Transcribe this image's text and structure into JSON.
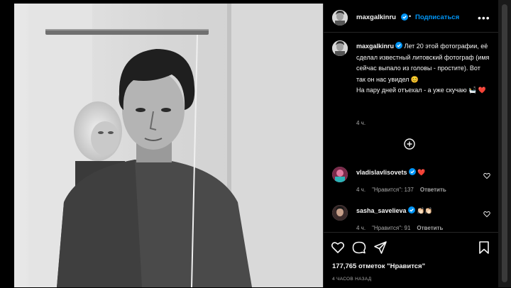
{
  "post": {
    "author": "maxgalkinru",
    "follow_label": "Подписаться",
    "separator": "•",
    "more_label": "•••",
    "caption": {
      "username": "maxgalkinru",
      "line1": " Лет 20 этой фотографии, её сделал известный литовский фотограф (имя сейчас выпало из головы - простите). Вот так он нас увидел 😊",
      "line2": "На пару дней отъехал - а уже скучаю 🛀 ❤️",
      "time": "4 ч."
    }
  },
  "comments": [
    {
      "username": "vladislavlisovets",
      "text": "❤️",
      "time": "4 ч.",
      "likes": "\"Нравится\": 137",
      "reply": "Ответить"
    },
    {
      "username": "sasha_savelieva",
      "text": "👏🏻👏🏻",
      "time": "4 ч.",
      "likes": "\"Нравится\": 91",
      "reply": "Ответить"
    }
  ],
  "footer": {
    "likes_count": "177,765 отметок \"Нравится\"",
    "time_ago": "4 ЧАСОВ НАЗАД"
  },
  "colors": {
    "accent": "#0095f6",
    "background": "#000000",
    "muted_text": "#a8a8a8",
    "heart": "#ed4956"
  },
  "icons": [
    "verified-icon",
    "more-icon",
    "add-comment-icon",
    "heart-icon",
    "comment-icon",
    "share-icon",
    "bookmark-icon"
  ]
}
